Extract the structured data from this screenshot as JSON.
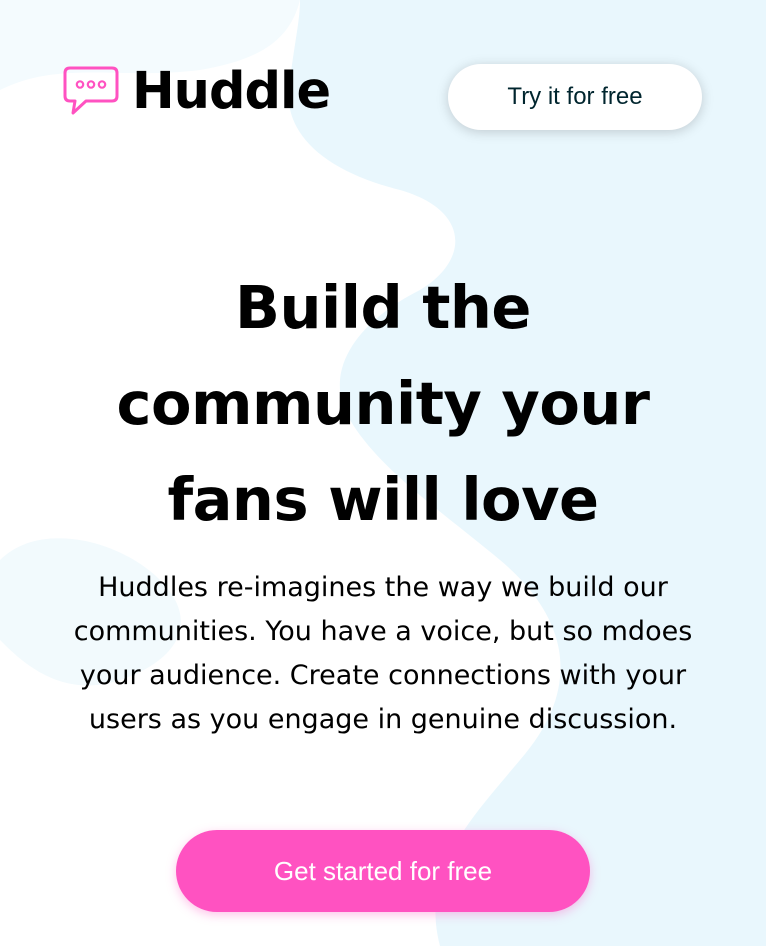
{
  "brand": {
    "name": "Huddle",
    "icon": "chat-bubble-icon",
    "accent_color": "#ff52c1"
  },
  "header": {
    "try_button_label": "Try it for free"
  },
  "hero": {
    "headline": "Build the community your fans will love",
    "description": "Huddles re-imagines the way we build our communities. You have a voice, but so mdoes your audience. Create connections with your users as you engage in genuine discussion.",
    "cta_label": "Get started for free",
    "cta_color": "#ff52c1"
  },
  "colors": {
    "background": "#ffffff",
    "background_pattern": "#eaf7fc",
    "text": "#000000"
  }
}
